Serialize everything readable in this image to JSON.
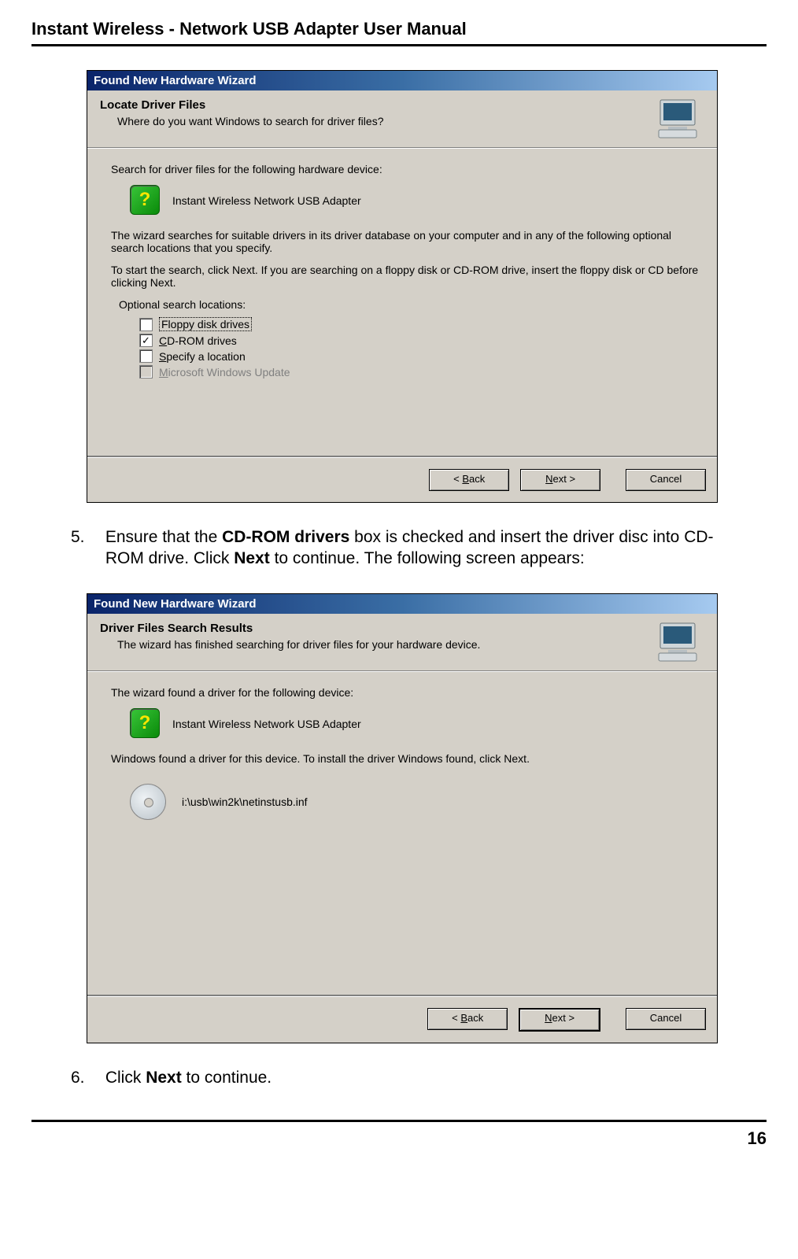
{
  "doc": {
    "title": "Instant Wireless - Network USB Adapter User Manual",
    "page_number": "16"
  },
  "dialog1": {
    "title": "Found New Hardware Wizard",
    "heading": "Locate Driver Files",
    "subheading": "Where do you want Windows to search for driver files?",
    "line1": "Search for driver files for the following hardware device:",
    "device": "Instant Wireless Network USB Adapter",
    "para1": "The wizard searches for suitable drivers in its driver database on your computer and in any of the following optional search locations that you specify.",
    "para2": "To start the search, click Next. If you are searching on a floppy disk or CD-ROM drive, insert the floppy disk or CD before clicking Next.",
    "opt_label": "Optional search locations:",
    "cb_floppy": "Floppy disk drives",
    "cb_cdrom": "CD-ROM drives",
    "cb_specify": "Specify a location",
    "cb_msupdate": "Microsoft Windows Update",
    "btn_back": "< Back",
    "btn_next": "Next >",
    "btn_cancel": "Cancel"
  },
  "step5": {
    "num": "5.",
    "text_a": "Ensure that the ",
    "bold_a": "CD-ROM drivers",
    "text_b": " box is checked and insert the driver disc into CD-ROM drive. Click ",
    "bold_b": "Next",
    "text_c": " to continue. The following screen appears:"
  },
  "dialog2": {
    "title": "Found New Hardware Wizard",
    "heading": "Driver Files Search Results",
    "subheading": "The wizard has finished searching for driver files for your hardware device.",
    "line1": "The wizard found a driver for the following device:",
    "device": "Instant Wireless Network USB Adapter",
    "para1": "Windows found a driver for this device. To install the driver Windows found, click Next.",
    "path": "i:\\usb\\win2k\\netinstusb.inf",
    "btn_back": "< Back",
    "btn_next": "Next >",
    "btn_cancel": "Cancel"
  },
  "step6": {
    "num": "6.",
    "text_a": "Click ",
    "bold_a": "Next",
    "text_b": " to continue."
  }
}
